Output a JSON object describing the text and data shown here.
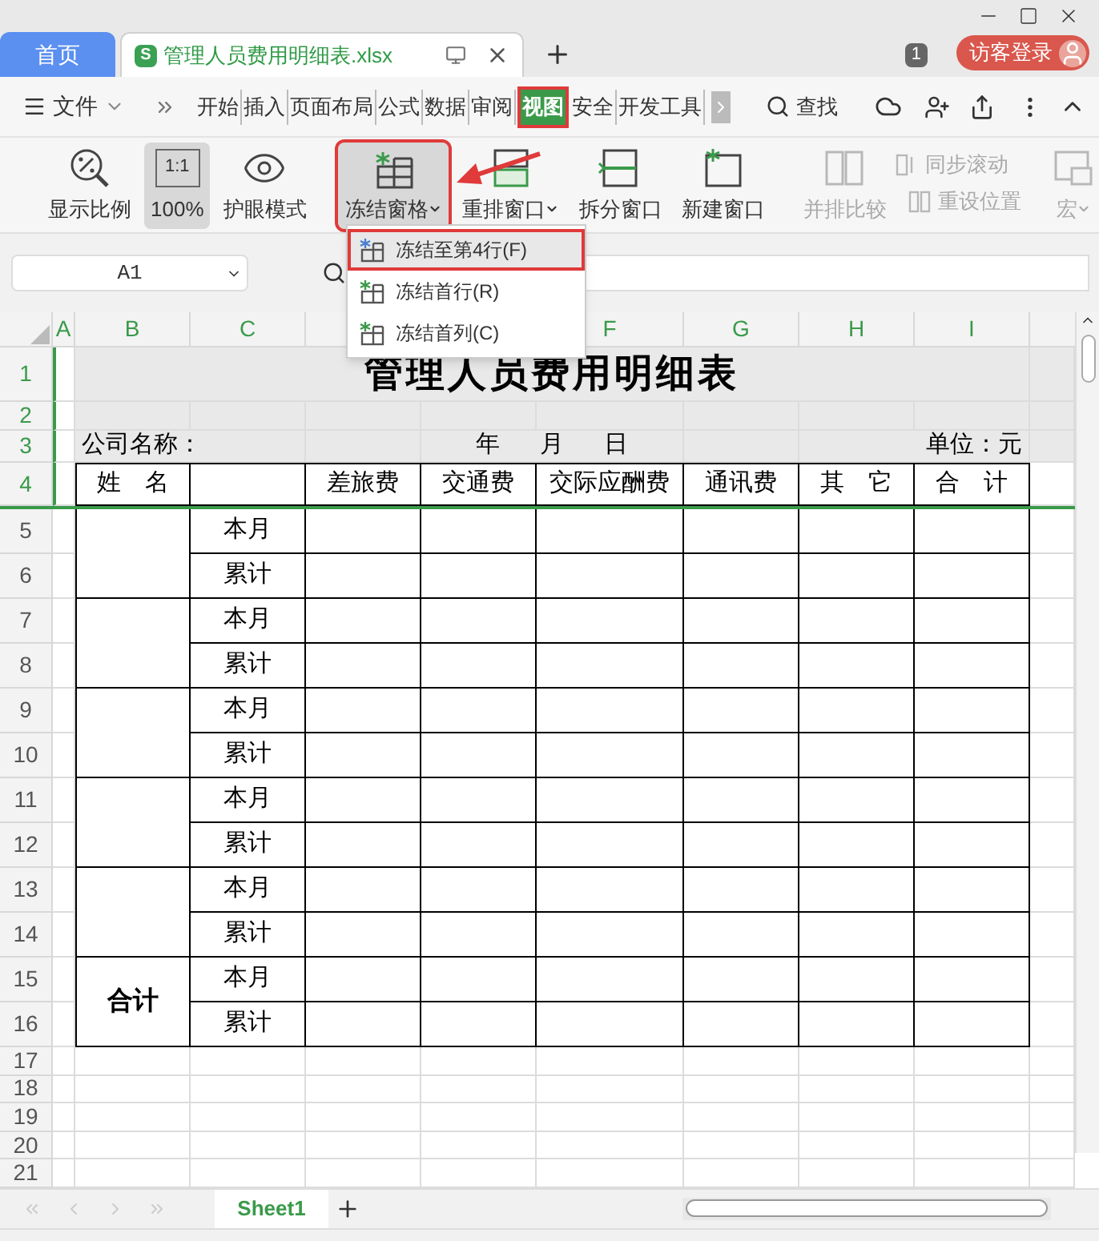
{
  "tabs": [
    {
      "label": "首页",
      "kind": "home",
      "selected": false
    },
    {
      "label": "管理人员费用明细表.xlsx",
      "kind": "file",
      "icon_text": "S",
      "selected": true
    }
  ],
  "account": {
    "badge": "1",
    "login": "访客登录"
  },
  "menu": {
    "file": "文件",
    "search": "查找",
    "tabs": [
      {
        "label": "开始",
        "selected": false
      },
      {
        "label": "插入",
        "selected": false
      },
      {
        "label": "页面布局",
        "selected": false
      },
      {
        "label": "公式",
        "selected": false
      },
      {
        "label": "数据",
        "selected": false
      },
      {
        "label": "审阅",
        "selected": false
      },
      {
        "label": "视图",
        "selected": true
      },
      {
        "label": "安全",
        "selected": false
      },
      {
        "label": "开发工具",
        "selected": false
      }
    ]
  },
  "ribbon": [
    {
      "kind": "large",
      "label": "显示比例",
      "selected": false,
      "disabled": false,
      "dropdown": false
    },
    {
      "kind": "large",
      "label": "100%",
      "icon_text": "1:1",
      "selected": true,
      "disabled": false,
      "dropdown": false
    },
    {
      "kind": "large",
      "label": "护眼模式",
      "selected": false,
      "disabled": false,
      "dropdown": false
    },
    {
      "kind": "separator"
    },
    {
      "kind": "large",
      "label": "冻结窗格",
      "selected": true,
      "disabled": false,
      "dropdown": true
    },
    {
      "kind": "large",
      "label": "重排窗口",
      "selected": false,
      "disabled": false,
      "dropdown": true
    },
    {
      "kind": "large",
      "label": "拆分窗口",
      "selected": false,
      "disabled": false,
      "dropdown": false
    },
    {
      "kind": "large",
      "label": "新建窗口",
      "selected": false,
      "disabled": false,
      "dropdown": false
    },
    {
      "kind": "separator"
    },
    {
      "kind": "large",
      "label": "并排比较",
      "selected": false,
      "disabled": true,
      "dropdown": false
    },
    {
      "kind": "small",
      "label": "同步滚动",
      "disabled": true
    },
    {
      "kind": "small",
      "label": "重设位置",
      "disabled": true
    },
    {
      "kind": "separator"
    },
    {
      "kind": "large",
      "label": "宏",
      "selected": false,
      "disabled": true,
      "dropdown": true
    }
  ],
  "dropdown": [
    {
      "label": "冻结至第4行(F)",
      "selected": true
    },
    {
      "label": "冻结首行(R)",
      "selected": false
    },
    {
      "label": "冻结首列(C)",
      "selected": false
    }
  ],
  "name_box": "A1",
  "sheet": {
    "columns": [
      "A",
      "B",
      "C",
      "",
      "",
      "F",
      "G",
      "H",
      "I"
    ],
    "rows": [
      {
        "label": "1",
        "frozen": true,
        "cells": [
          "",
          "管理人员费用明细表"
        ]
      },
      {
        "label": "2",
        "frozen": true
      },
      {
        "label": "3",
        "frozen": true,
        "cells": [
          "",
          "公司名称：",
          "",
          "",
          "年      月      日",
          "",
          "",
          "单位：元"
        ]
      },
      {
        "label": "4",
        "frozen": true,
        "cells": [
          "",
          "姓　名",
          "",
          "差旅费",
          "交通费",
          "交际应酬费",
          "通讯费",
          "其　它",
          "合　计"
        ]
      },
      {
        "label": "5",
        "frozen": false,
        "cells": [
          "",
          "",
          "本月"
        ]
      },
      {
        "label": "6",
        "frozen": false,
        "cells": [
          "",
          "",
          "累计"
        ]
      },
      {
        "label": "7",
        "frozen": false,
        "cells": [
          "",
          "",
          "本月"
        ]
      },
      {
        "label": "8",
        "frozen": false,
        "cells": [
          "",
          "",
          "累计"
        ]
      },
      {
        "label": "9",
        "frozen": false,
        "cells": [
          "",
          "",
          "本月"
        ]
      },
      {
        "label": "10",
        "frozen": false,
        "cells": [
          "",
          "",
          "累计"
        ]
      },
      {
        "label": "11",
        "frozen": false,
        "cells": [
          "",
          "",
          "本月"
        ]
      },
      {
        "label": "12",
        "frozen": false,
        "cells": [
          "",
          "",
          "累计"
        ]
      },
      {
        "label": "13",
        "frozen": false,
        "cells": [
          "",
          "",
          "本月"
        ]
      },
      {
        "label": "14",
        "frozen": false,
        "cells": [
          "",
          "",
          "累计"
        ]
      },
      {
        "label": "15",
        "frozen": false,
        "cells": [
          "",
          "合计",
          "本月"
        ]
      },
      {
        "label": "16",
        "frozen": false,
        "cells": [
          "",
          "",
          "累计"
        ]
      },
      {
        "label": "17",
        "frozen": false
      },
      {
        "label": "18",
        "frozen": false
      },
      {
        "label": "19",
        "frozen": false
      },
      {
        "label": "20",
        "frozen": false
      },
      {
        "label": "21",
        "frozen": false
      }
    ]
  },
  "sheet_tabs": [
    {
      "label": "Sheet1",
      "selected": true
    }
  ]
}
